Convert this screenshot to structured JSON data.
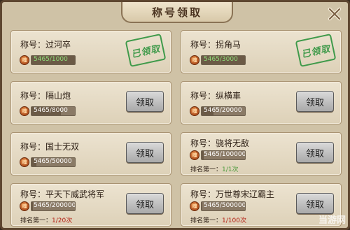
{
  "window": {
    "title": "称号领取"
  },
  "colors": {
    "frame": "#cfc2a6",
    "card": "#e6dcc6",
    "stamp_green": "#3f9a4a",
    "rank_red": "#b41c10",
    "rank_green": "#4a9a3a"
  },
  "icons": {
    "close": "close-x-icon",
    "currency": "coin-icon"
  },
  "coin_glyph": "魂",
  "cards": [
    {
      "name": "称号：过河卒",
      "progress": "5465/1000",
      "ratio": 1.0,
      "status": "claimed",
      "stamp": "已领取"
    },
    {
      "name": "称号：拐角马",
      "progress": "5465/3000",
      "ratio": 1.0,
      "status": "claimed",
      "stamp": "已领取"
    },
    {
      "name": "称号：隔山炮",
      "progress": "5465/8000",
      "ratio": 0.68,
      "status": "unclaimed",
      "button": "领取"
    },
    {
      "name": "称号：纵横車",
      "progress": "5465/20000",
      "ratio": 0.27,
      "status": "unclaimed",
      "button": "领取"
    },
    {
      "name": "称号：国士无双",
      "progress": "5465/50000",
      "ratio": 0.11,
      "status": "unclaimed",
      "button": "领取"
    },
    {
      "name": "称号：骁将无敌",
      "progress": "5465/100000",
      "ratio": 0.05,
      "status": "unclaimed",
      "button": "领取",
      "rank_label": "排名第一：",
      "rank_value": "1/1次"
    },
    {
      "name": "称号：平天下威武将军",
      "progress": "5465/200000",
      "ratio": 0.03,
      "status": "unclaimed",
      "button": "领取",
      "rank_label": "排名第一：",
      "rank_value": "1/20次"
    },
    {
      "name": "称号：万世尊宋辽霸主",
      "progress": "5465/500000",
      "ratio": 0.01,
      "status": "unclaimed",
      "button": "领取",
      "rank_label": "排名第一：",
      "rank_value": "1/100次"
    }
  ],
  "watermark": {
    "text": "当游网"
  }
}
